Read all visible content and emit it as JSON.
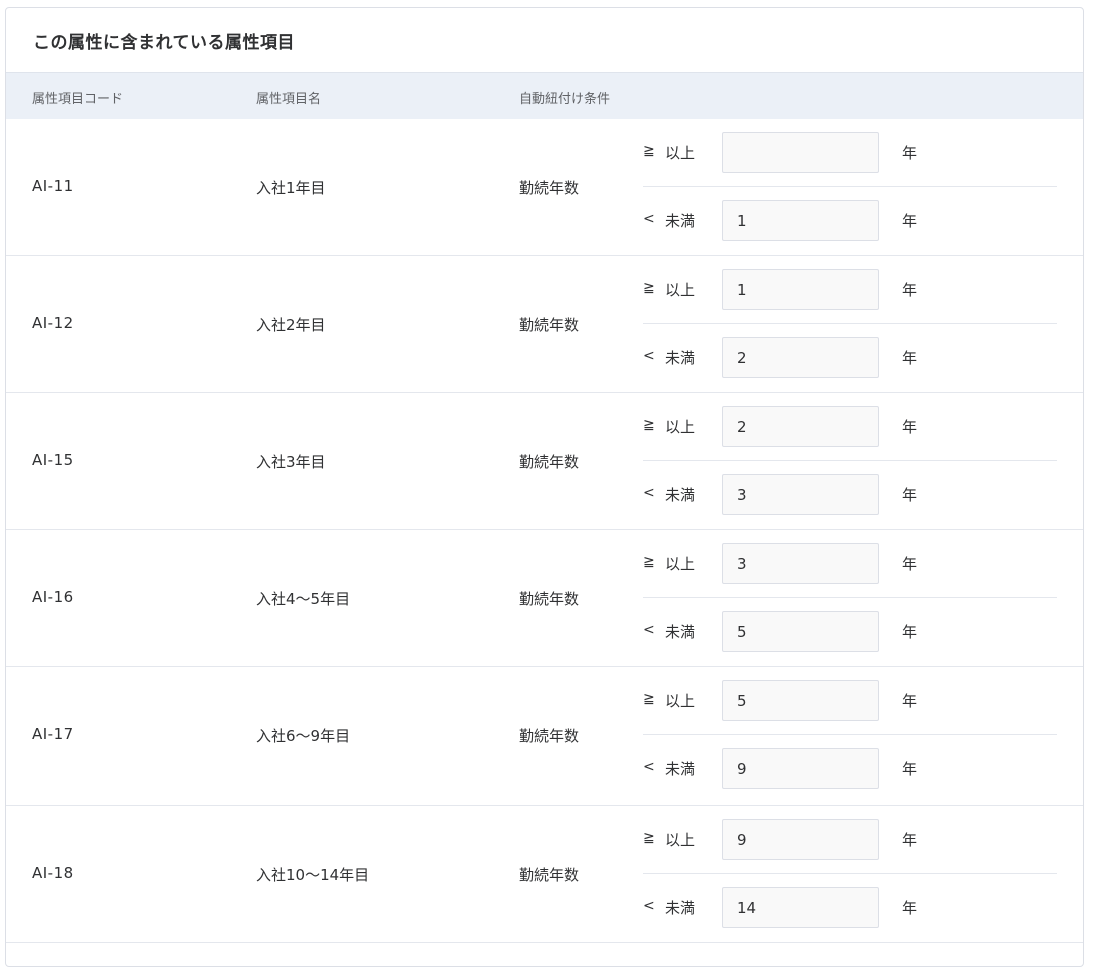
{
  "card": {
    "title": "この属性に含まれている属性項目"
  },
  "table": {
    "headers": {
      "code": "属性項目コード",
      "name": "属性項目名",
      "condition": "自動紐付け条件"
    },
    "rows": [
      {
        "code": "AI-11",
        "name": "入社1年目",
        "condition": "勤続年数",
        "min": {
          "symbol": "≧",
          "label": "以上",
          "value": "",
          "unit": "年"
        },
        "max": {
          "symbol": "<",
          "label": "未満",
          "value": "1",
          "unit": "年"
        }
      },
      {
        "code": "AI-12",
        "name": "入社2年目",
        "condition": "勤続年数",
        "min": {
          "symbol": "≧",
          "label": "以上",
          "value": "1",
          "unit": "年"
        },
        "max": {
          "symbol": "<",
          "label": "未満",
          "value": "2",
          "unit": "年"
        }
      },
      {
        "code": "AI-15",
        "name": "入社3年目",
        "condition": "勤続年数",
        "min": {
          "symbol": "≧",
          "label": "以上",
          "value": "2",
          "unit": "年"
        },
        "max": {
          "symbol": "<",
          "label": "未満",
          "value": "3",
          "unit": "年"
        }
      },
      {
        "code": "AI-16",
        "name": "入社4～5年目",
        "condition": "勤続年数",
        "min": {
          "symbol": "≧",
          "label": "以上",
          "value": "3",
          "unit": "年"
        },
        "max": {
          "symbol": "<",
          "label": "未満",
          "value": "5",
          "unit": "年"
        }
      },
      {
        "code": "AI-17",
        "name": "入社6～9年目",
        "condition": "勤続年数",
        "min": {
          "symbol": "≧",
          "label": "以上",
          "value": "5",
          "unit": "年"
        },
        "max": {
          "symbol": "<",
          "label": "未満",
          "value": "9",
          "unit": "年"
        }
      },
      {
        "code": "AI-18",
        "name": "入社10～14年目",
        "condition": "勤続年数",
        "min": {
          "symbol": "≧",
          "label": "以上",
          "value": "9",
          "unit": "年"
        },
        "max": {
          "symbol": "<",
          "label": "未満",
          "value": "14",
          "unit": "年"
        }
      }
    ]
  }
}
